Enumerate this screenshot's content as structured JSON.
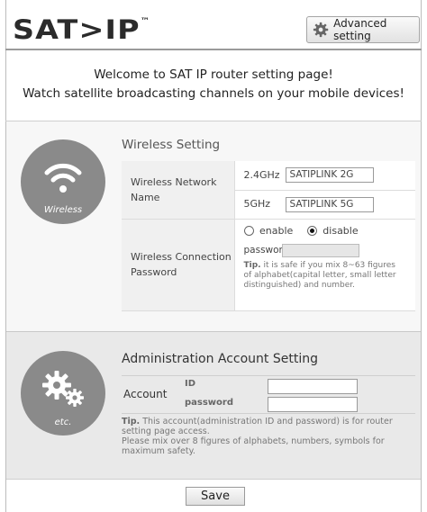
{
  "header": {
    "logo_text": "SAT>IP",
    "logo_tm": "™",
    "advanced_button_label": "Advanced setting"
  },
  "welcome": {
    "line1": "Welcome to SAT IP router setting page!",
    "line2": "Watch satellite broadcasting channels on your mobile devices!"
  },
  "wireless": {
    "icon_label": "Wireless",
    "title": "Wireless Setting",
    "network_name_label": "Wireless Network Name",
    "band_24": "2.4GHz",
    "ssid_24": "SATIPLINK 2G",
    "band_5": "5GHz",
    "ssid_5": "SATIPLINK 5G",
    "connection_label": "Wireless Connection Password",
    "enable_label": "enable",
    "disable_label": "disable",
    "selected": "disable",
    "password_label": "password",
    "password_value": "",
    "tip_title": "Tip.",
    "tip_text": "it is safe if you mix 8~63 figures of alphabet(capital letter, small letter distinguished) and number."
  },
  "admin": {
    "icon_label": "etc.",
    "title": "Administration Account Setting",
    "account_label": "Account",
    "id_label": "ID",
    "password_label": "password",
    "id_value": "",
    "password_value": "",
    "tip_title": "Tip.",
    "tip_line1": "This account(administration ID and password) is for router setting page access.",
    "tip_line2": "Please mix over 8 figures of alphabets, numbers, symbols for maximum safety."
  },
  "footer": {
    "save_label": "Save"
  },
  "colors": {
    "icon_circle": "#8a8a8a",
    "wireless_bg": "#f7f7f7",
    "admin_bg": "#e9e9e9"
  }
}
